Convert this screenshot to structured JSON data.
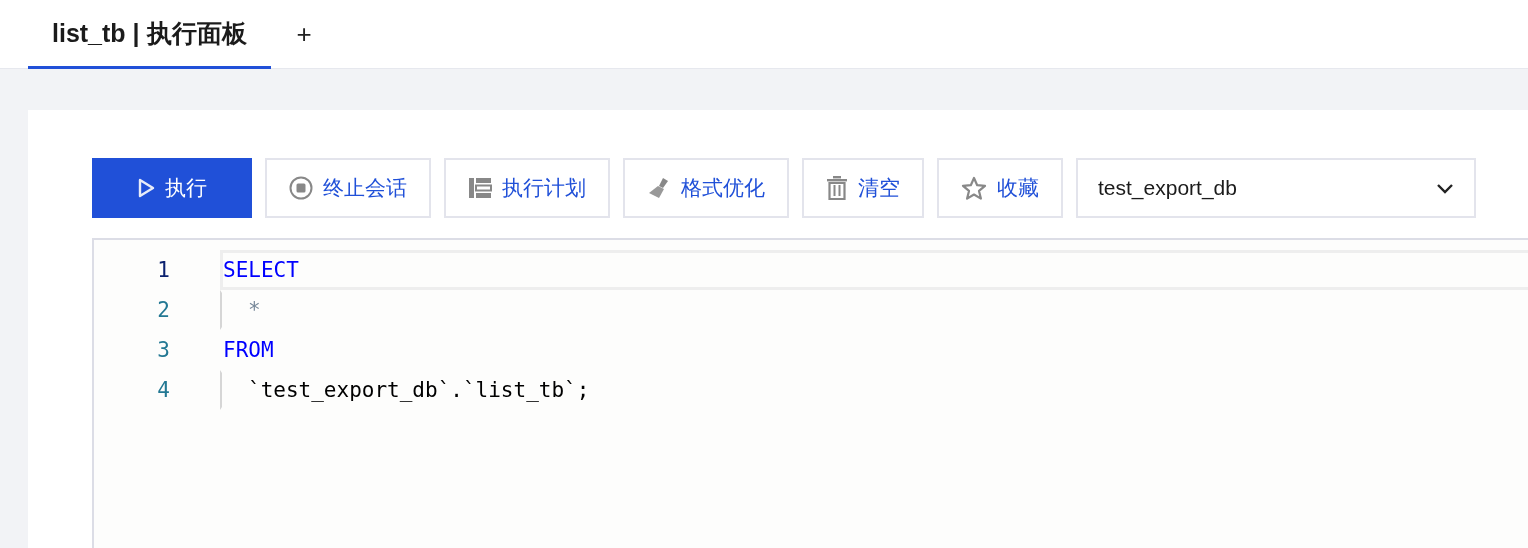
{
  "tabs": [
    {
      "label": "list_tb | 执行面板",
      "selected": true
    }
  ],
  "add_tab": "+",
  "toolbar": {
    "buttons": [
      {
        "label": "执行",
        "kind": "run"
      },
      {
        "label": "终止会话",
        "kind": "stop"
      },
      {
        "label": "执行计划",
        "kind": "plan"
      },
      {
        "label": "格式优化",
        "kind": "format"
      },
      {
        "label": "清空",
        "kind": "clear"
      },
      {
        "label": "收藏",
        "kind": "favorite"
      }
    ],
    "database_select": {
      "value": "test_export_db"
    }
  },
  "editor": {
    "lines": [
      {
        "number": "1",
        "current": true,
        "indented": false,
        "tokens": [
          {
            "kind": "keyword",
            "text": "SELECT"
          }
        ]
      },
      {
        "number": "2",
        "current": false,
        "indented": true,
        "tokens": [
          {
            "kind": "operator",
            "text": "*"
          }
        ]
      },
      {
        "number": "3",
        "current": false,
        "indented": false,
        "tokens": [
          {
            "kind": "keyword",
            "text": "FROM"
          }
        ]
      },
      {
        "number": "4",
        "current": false,
        "indented": true,
        "tokens": [
          {
            "kind": "identifier",
            "text": "`test_export_db`.`list_tb`;"
          }
        ]
      }
    ]
  }
}
